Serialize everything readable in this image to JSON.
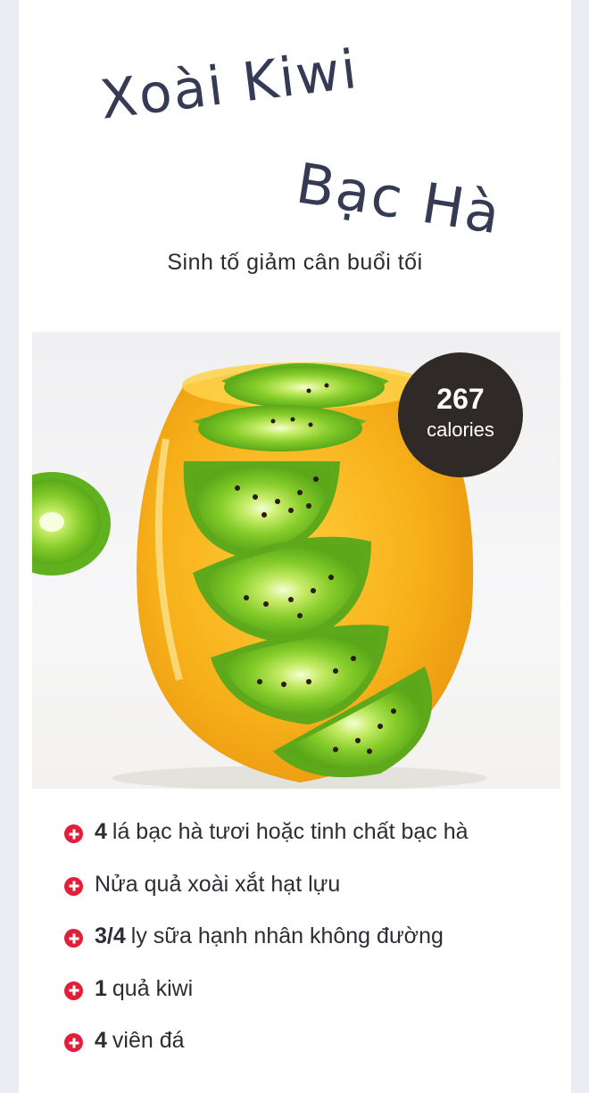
{
  "title": {
    "line1": "Xoài Kiwi",
    "line2": "Bạc Hà"
  },
  "subtitle": "Sinh tố giảm cân buổi tối",
  "calories": {
    "value": "267",
    "unit": "calories"
  },
  "ingredients": [
    {
      "qty": "4",
      "text": "lá bạc hà tươi hoặc tinh chất bạc hà"
    },
    {
      "qty": "",
      "text": "Nửa quả xoài xắt hạt lựu"
    },
    {
      "qty": "3/4",
      "text": "ly sữa hạnh nhân không đường"
    },
    {
      "qty": "1",
      "text": "quả kiwi"
    },
    {
      "qty": "4",
      "text": "viên đá"
    }
  ],
  "colors": {
    "title": "#353a55",
    "badge": "#2f2a28",
    "bullet": "#e0203a",
    "smoothie": "#f6b21a",
    "kiwi": "#7ccb2a"
  },
  "icons": {
    "bullet": "plus-circle-icon"
  }
}
